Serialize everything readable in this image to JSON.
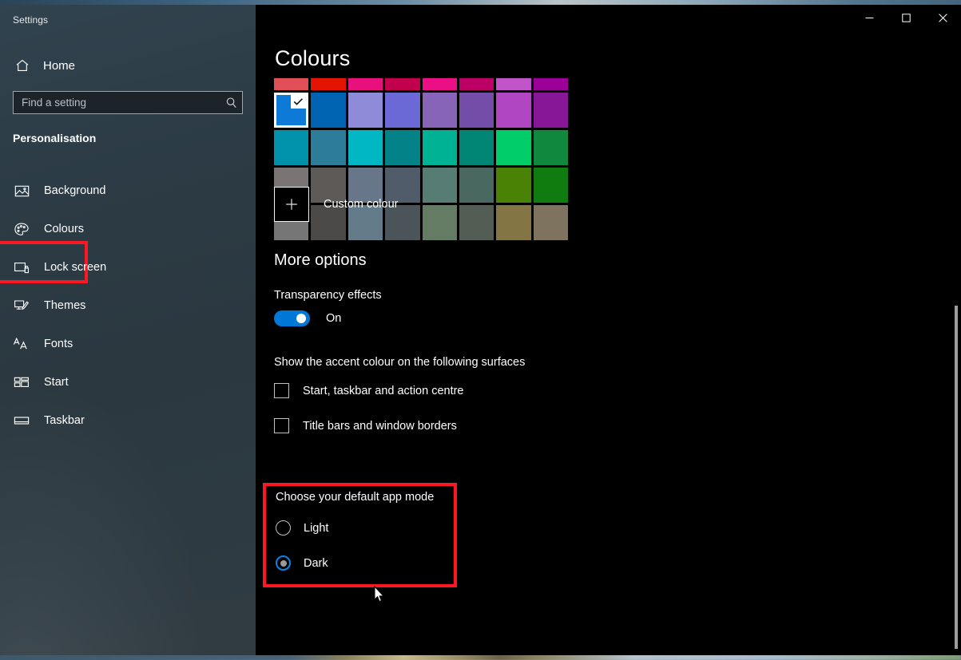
{
  "window": {
    "title": "Settings",
    "controls": [
      {
        "name": "minimize-button",
        "glyph": "─"
      },
      {
        "name": "maximize-button",
        "glyph": "□"
      },
      {
        "name": "close-button",
        "glyph": "✕"
      }
    ]
  },
  "sidebar": {
    "home_label": "Home",
    "home_icon": "home-icon",
    "search": {
      "placeholder": "Find a setting",
      "value": "",
      "icon": "search-icon"
    },
    "category": "Personalisation",
    "items": [
      {
        "label": "Background",
        "icon": "picture-icon",
        "selected": false,
        "highlighted": false
      },
      {
        "label": "Colours",
        "icon": "palette-icon",
        "selected": true,
        "highlighted": true
      },
      {
        "label": "Lock screen",
        "icon": "lock-screen-icon",
        "selected": false,
        "highlighted": false
      },
      {
        "label": "Themes",
        "icon": "themes-icon",
        "selected": false,
        "highlighted": false
      },
      {
        "label": "Fonts",
        "icon": "fonts-icon",
        "selected": false,
        "highlighted": false
      },
      {
        "label": "Start",
        "icon": "start-icon",
        "selected": false,
        "highlighted": false
      },
      {
        "label": "Taskbar",
        "icon": "taskbar-icon",
        "selected": false,
        "highlighted": false
      }
    ]
  },
  "main": {
    "page_title": "Colours",
    "swatch_grid": {
      "selected_index": 8,
      "selected_colour": "#0c7ad6",
      "rows": [
        {
          "clipped": true,
          "colours": [
            "#e04e56",
            "#e51400",
            "#e8107d",
            "#c3004d",
            "#eb0e84",
            "#bd0065",
            "#c054c8",
            "#9b0097"
          ]
        },
        {
          "clipped": false,
          "colours": [
            "#0c7ad6",
            "#0063b1",
            "#8e8cd8",
            "#6b69d6",
            "#8764b8",
            "#744da9",
            "#b146c2",
            "#881798"
          ]
        },
        {
          "clipped": false,
          "colours": [
            "#0091ab",
            "#2d7d9a",
            "#00b7c3",
            "#038387",
            "#00b294",
            "#018574",
            "#00cc6a",
            "#10893e"
          ]
        },
        {
          "clipped": false,
          "colours": [
            "#7a7574",
            "#5d5a58",
            "#68768a",
            "#515c6b",
            "#567c73",
            "#486860",
            "#498205",
            "#107c10"
          ]
        },
        {
          "clipped": false,
          "colours": [
            "#767676",
            "#4c4a48",
            "#647c8a",
            "#4a5459",
            "#647c64",
            "#525e54",
            "#847545",
            "#7e735f"
          ]
        }
      ]
    },
    "custom_colour": {
      "label": "Custom colour",
      "icon": "plus-icon"
    },
    "more_options_heading": "More options",
    "transparency": {
      "label": "Transparency effects",
      "state": "On",
      "on": true
    },
    "surfaces_label": "Show the accent colour on the following surfaces",
    "checkboxes": [
      {
        "label": "Start, taskbar and action centre",
        "checked": false
      },
      {
        "label": "Title bars and window borders",
        "checked": false
      }
    ],
    "app_mode": {
      "title": "Choose your default app mode",
      "options": [
        {
          "label": "Light",
          "selected": false
        },
        {
          "label": "Dark",
          "selected": true
        }
      ]
    }
  },
  "annotations": {
    "highlight_colour": "#ff1721",
    "targets": [
      "Colours",
      "Choose your default app mode"
    ]
  },
  "colors": {
    "accent": "#0078d7",
    "window_background": "#000000",
    "nav_background": "#2c3b45",
    "text": "#ffffff"
  }
}
